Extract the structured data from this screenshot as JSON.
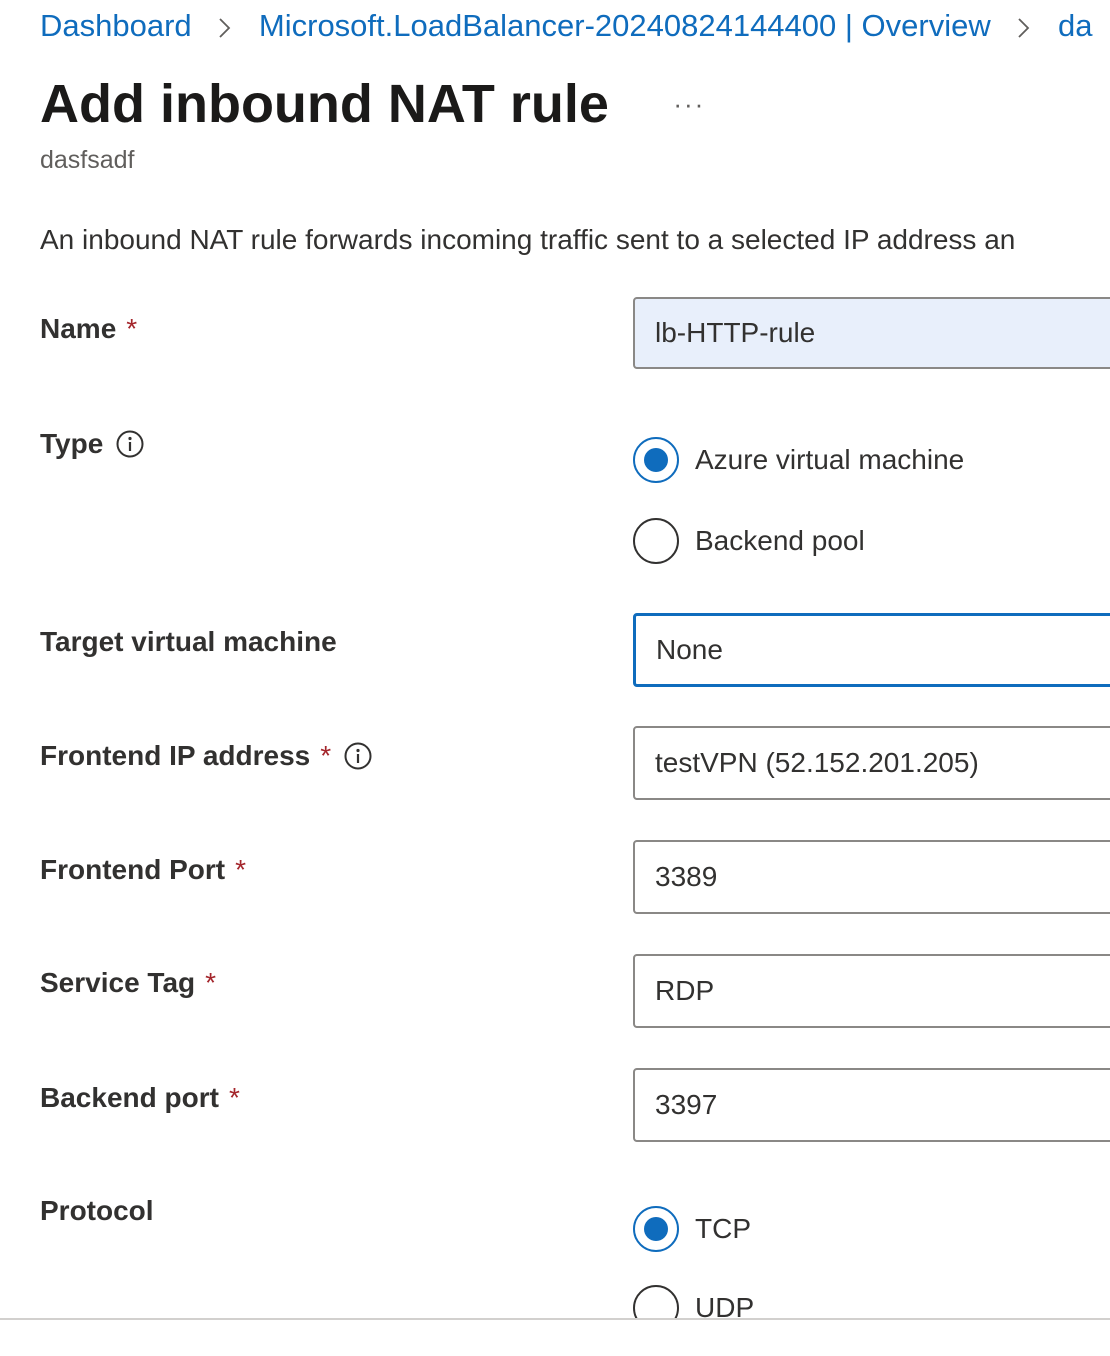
{
  "breadcrumb": {
    "items": [
      "Dashboard",
      "Microsoft.LoadBalancer-20240824144400 | Overview",
      "da"
    ]
  },
  "header": {
    "title": "Add inbound NAT rule",
    "more": "···",
    "subtitle": "dasfsadf"
  },
  "description": "An inbound NAT rule forwards incoming traffic sent to a selected IP address an",
  "required_mark": "*",
  "form": {
    "name": {
      "label": "Name",
      "value": "lb-HTTP-rule"
    },
    "type": {
      "label": "Type",
      "options": [
        "Azure virtual machine",
        "Backend pool"
      ],
      "selected": "Azure virtual machine"
    },
    "target_vm": {
      "label": "Target virtual machine",
      "value": "None"
    },
    "frontend_ip": {
      "label": "Frontend IP address",
      "value": "testVPN (52.152.201.205)"
    },
    "frontend_port": {
      "label": "Frontend Port",
      "value": "3389"
    },
    "service_tag": {
      "label": "Service Tag",
      "value": "RDP"
    },
    "backend_port": {
      "label": "Backend port",
      "value": "3397"
    },
    "protocol": {
      "label": "Protocol",
      "options": [
        "TCP",
        "UDP"
      ],
      "selected": "TCP"
    }
  },
  "colors": {
    "link": "#0f6cbd",
    "required": "#a4262c",
    "radio_selected": "#0f6cbd",
    "filled_field_bg": "#e8effb",
    "text": "#323130"
  },
  "icons": {
    "breadcrumb_separator": "chevron-right-icon",
    "info": "info-icon"
  }
}
